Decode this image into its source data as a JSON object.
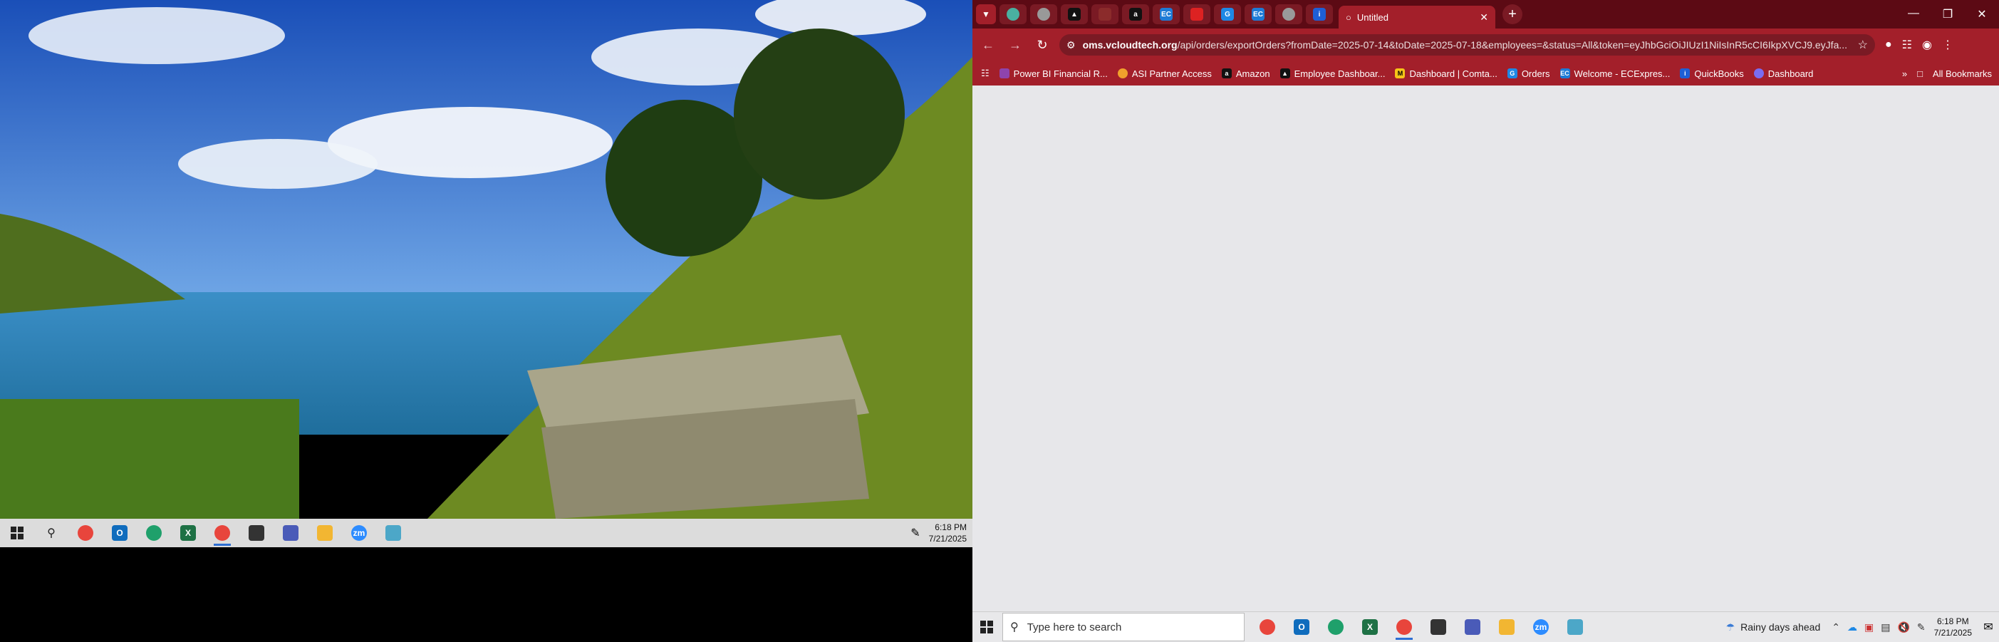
{
  "left_taskbar": {
    "time": "6:18 PM",
    "date": "7/21/2025"
  },
  "browser": {
    "active_tab_title": "Untitled",
    "url_host": "oms.vcloudtech.org",
    "url_rest": "/api/orders/exportOrders?fromDate=2025-07-14&toDate=2025-07-18&employees=&status=All&token=eyJhbGciOiJIUzI1NiIsInR5cCI6IkpXVCJ9.eyJfa...",
    "bookmarks": [
      {
        "label": "Power BI Financial R...",
        "color": "#8e44ad"
      },
      {
        "label": "ASI Partner Access",
        "color": "#f1a12c"
      },
      {
        "label": "Amazon",
        "color": "#111111"
      },
      {
        "label": "Employee Dashboar...",
        "color": "#111111"
      },
      {
        "label": "Dashboard | Comta...",
        "color": "#f5c518"
      },
      {
        "label": "Orders",
        "color": "#1e88e5"
      },
      {
        "label": "Welcome - ECExpres...",
        "color": "#1e7bd6"
      },
      {
        "label": "QuickBooks",
        "color": "#2ca01c"
      },
      {
        "label": "Dashboard",
        "color": "#7a6cf0"
      }
    ],
    "all_bookmarks": "All Bookmarks"
  },
  "right_taskbar": {
    "search_placeholder": "Type here to search",
    "weather": "Rainy days ahead",
    "time": "6:18 PM",
    "date": "7/21/2025"
  }
}
